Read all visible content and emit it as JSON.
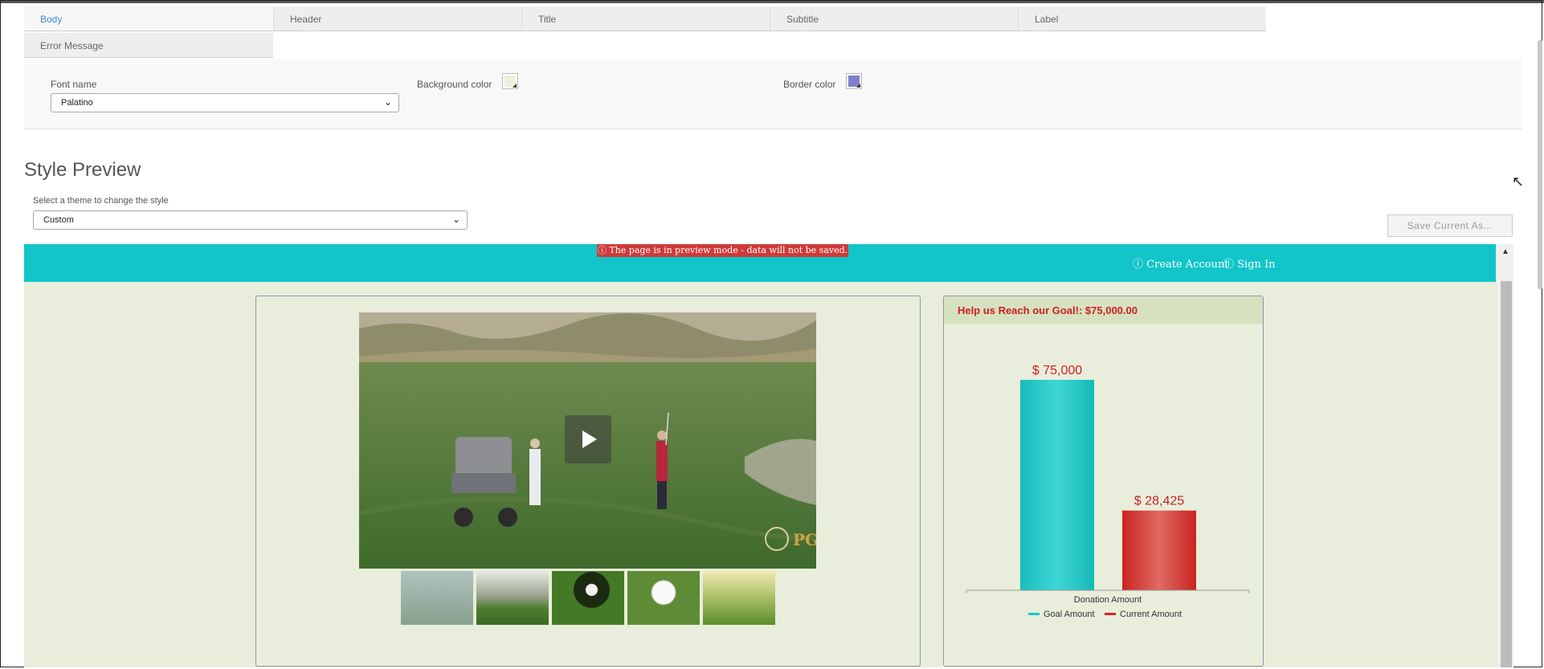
{
  "tabs": [
    "Body",
    "Header",
    "Title",
    "Subtitle",
    "Label",
    "Error Message"
  ],
  "active_tab": "Body",
  "settings": {
    "font_name_label": "Font name",
    "font_name_value": "Palatino",
    "background_color_label": "Background color",
    "background_color": "#eeeedd",
    "border_color_label": "Border color",
    "border_color": "#8080cc"
  },
  "style_preview": {
    "heading": "Style Preview",
    "theme_label": "Select a theme to change the style",
    "theme_value": "Custom",
    "save_button": "Save Current As..."
  },
  "preview": {
    "banner": "The page is in preview mode - data will not be saved.",
    "create_account": "Create Account",
    "sign_in": "Sign In",
    "header_color": "#12c5c9",
    "body_color": "#e8eedb",
    "goal_heading": "Help us Reach our Goal!: $75,000.00"
  },
  "chart_data": {
    "type": "bar",
    "categories": [
      "Donation Amount"
    ],
    "series": [
      {
        "name": "Goal Amount",
        "values": [
          75000
        ],
        "label": "$ 75,000",
        "color": "#1cc7c8"
      },
      {
        "name": "Current Amount",
        "values": [
          28425
        ],
        "label": "$ 28,425",
        "color": "#cf2a24"
      }
    ],
    "xlabel": "Donation Amount",
    "ylim": [
      0,
      75000
    ],
    "legend_position": "bottom"
  },
  "icons": [
    "play-icon",
    "info-icon",
    "chevron-down-icon",
    "mouse-cursor-icon"
  ]
}
